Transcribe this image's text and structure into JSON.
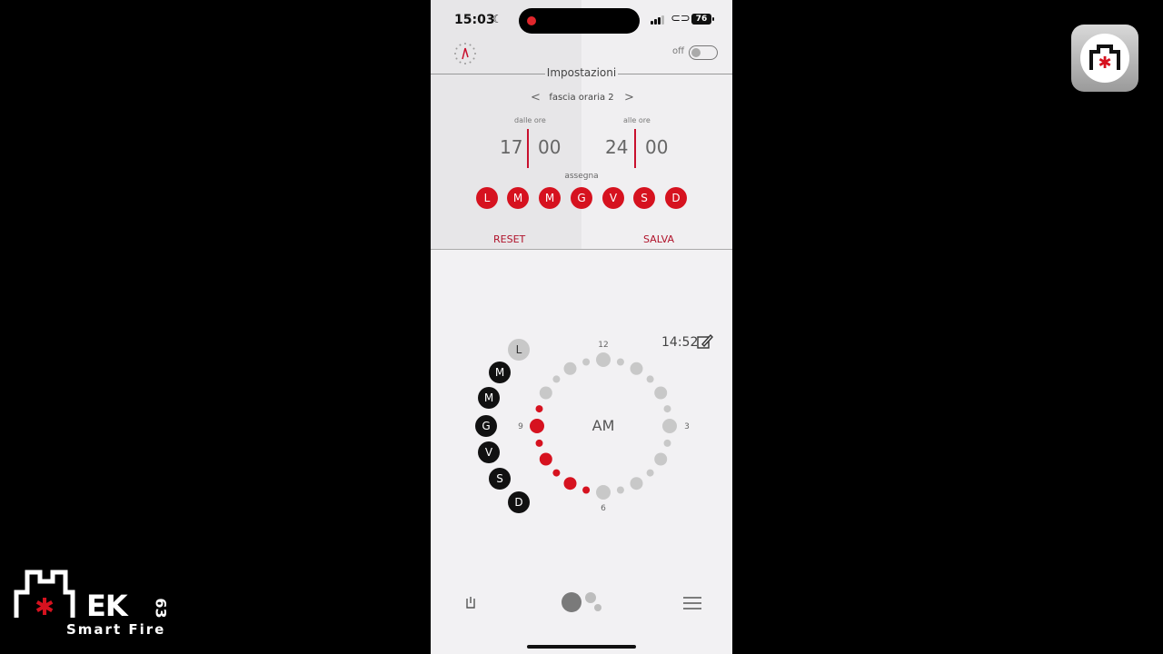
{
  "status_bar": {
    "time": "15:03",
    "battery": "76"
  },
  "header": {
    "toggle_label": "off",
    "title": "Impostazioni"
  },
  "slot": {
    "prev": "<",
    "next": ">",
    "label": "fascia oraria 2"
  },
  "from": {
    "label": "dalle ore",
    "hour": "17",
    "minute": "00"
  },
  "to": {
    "label": "alle ore",
    "hour": "24",
    "minute": "00"
  },
  "assign_label": "assegna",
  "assign_days": [
    "L",
    "M",
    "M",
    "G",
    "V",
    "S",
    "D"
  ],
  "actions": {
    "reset": "RESET",
    "save": "SALVA"
  },
  "dial": {
    "current_time": "14:52",
    "period": "AM",
    "hour_labels": {
      "12": "12",
      "3": "3",
      "6": "6",
      "9": "9"
    },
    "week_days": [
      {
        "label": "L",
        "active": false
      },
      {
        "label": "M",
        "active": true
      },
      {
        "label": "M",
        "active": true
      },
      {
        "label": "G",
        "active": true
      },
      {
        "label": "V",
        "active": true
      },
      {
        "label": "S",
        "active": true
      },
      {
        "label": "D",
        "active": true
      }
    ],
    "active_color": "#d6121f",
    "inactive_color": "#c8c8c8"
  },
  "brand": {
    "logo_text": "EK",
    "model": "63",
    "tagline": "Smart Fire"
  },
  "colors": {
    "accent": "#d6121f",
    "action": "#b0122a"
  },
  "icons": [
    "clock-icon",
    "power-icon",
    "menu-icon",
    "edit-icon",
    "app-logo-icon",
    "brand-logo-icon"
  ]
}
